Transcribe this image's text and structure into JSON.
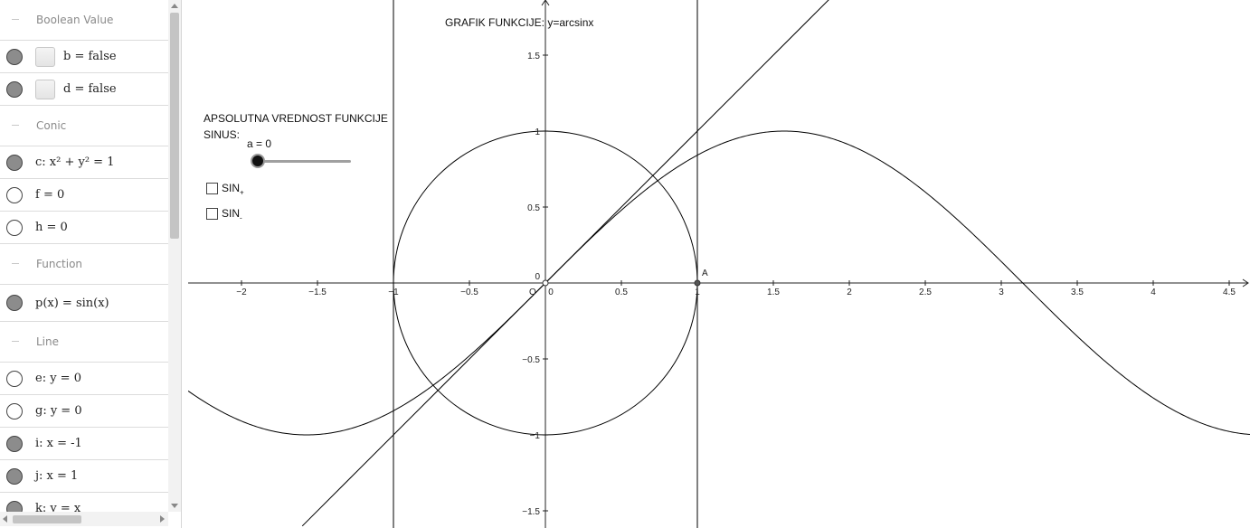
{
  "algebra": {
    "groups": [
      {
        "title": "Boolean Value",
        "items": [
          {
            "name": "b",
            "expr": "b = false",
            "visible": true,
            "type": "checkbox"
          },
          {
            "name": "d",
            "expr": "d = false",
            "visible": true,
            "type": "checkbox"
          }
        ]
      },
      {
        "title": "Conic",
        "items": [
          {
            "name": "c",
            "expr": "c: x² + y² = 1",
            "visible": true
          },
          {
            "name": "f",
            "expr": "f = 0",
            "visible": false
          },
          {
            "name": "h",
            "expr": "h = 0",
            "visible": false
          }
        ]
      },
      {
        "title": "Function",
        "items": [
          {
            "name": "p",
            "expr": "p(x) = sin(x)",
            "visible": true
          }
        ]
      },
      {
        "title": "Line",
        "items": [
          {
            "name": "e",
            "expr": "e: y = 0",
            "visible": false
          },
          {
            "name": "g",
            "expr": "g: y = 0",
            "visible": false
          },
          {
            "name": "i",
            "expr": "i: x = -1",
            "visible": true
          },
          {
            "name": "j",
            "expr": "j: x = 1",
            "visible": true
          },
          {
            "name": "k",
            "expr": "k: y = x",
            "visible": true
          }
        ]
      }
    ]
  },
  "graphics": {
    "title": "GRAFIK FUNKCIJE:  y=arcsinx",
    "caption_line1": "APSOLUTNA VREDNOST FUNKCIJE",
    "caption_line2": "SINUS:",
    "slider_label": "a = 0",
    "slider_value": 0,
    "checkbox1_label": "SIN",
    "checkbox1_sub": "+",
    "checkbox2_label": "SIN",
    "checkbox2_sub": "-",
    "point_A_label": "A",
    "origin_label": "O",
    "x_ticks": [
      "−2",
      "−1.5",
      "−1",
      "−0.5",
      "0",
      "0.5",
      "1",
      "1.5",
      "2",
      "2.5",
      "3",
      "3.5",
      "4",
      "4.5"
    ],
    "y_ticks": [
      "1.5",
      "1",
      "0.5",
      "0",
      "−0.5",
      "−1",
      "−1.5"
    ]
  },
  "colors": {
    "accent": "#8c8c8c",
    "curve": "#000000"
  }
}
